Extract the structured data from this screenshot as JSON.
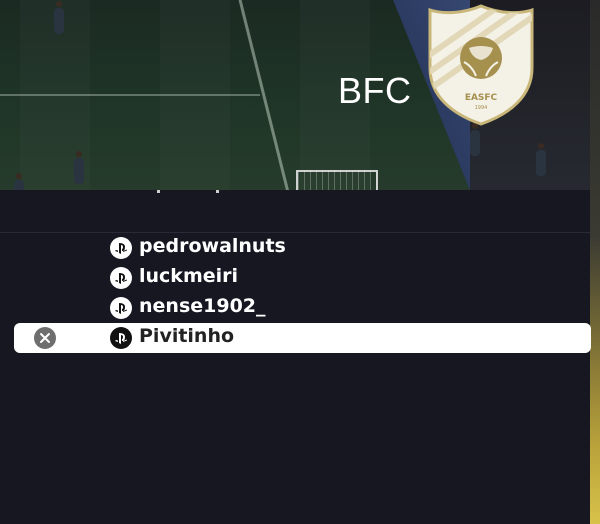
{
  "header": {
    "team_name": "BFC",
    "badge_text": "EASFC",
    "badge_year": "1994"
  },
  "players": [
    {
      "name": "pedrowalnuts",
      "platform_icon": "playstation-icon",
      "selected": false
    },
    {
      "name": "luckmeiri",
      "platform_icon": "playstation-icon",
      "selected": false
    },
    {
      "name": "nense1902_",
      "platform_icon": "playstation-icon",
      "selected": false
    },
    {
      "name": "Pivitinho",
      "platform_icon": "playstation-icon",
      "selected": true,
      "action_icon": "remove-icon"
    }
  ],
  "colors": {
    "panel_bg": "#171722",
    "selected_row_bg": "#ffffff",
    "badge_gold": "#a6904e"
  }
}
